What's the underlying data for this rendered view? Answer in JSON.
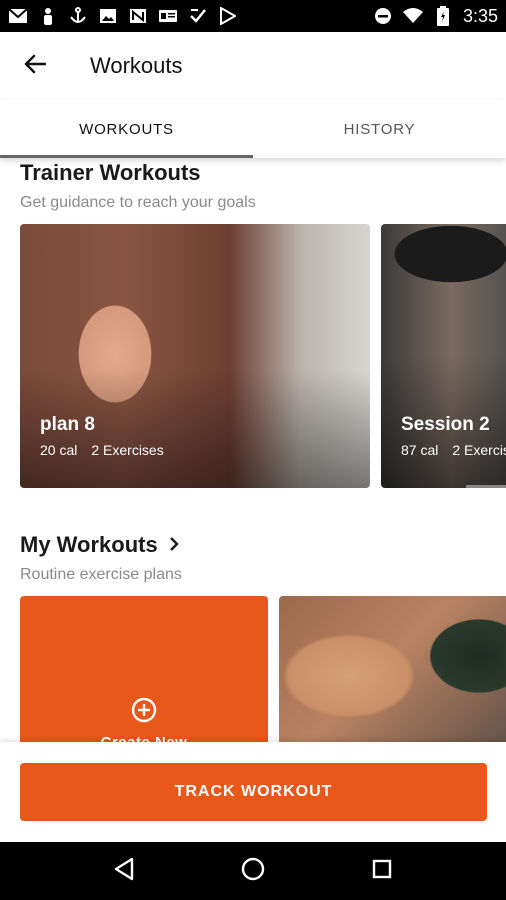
{
  "status_bar": {
    "time": "3:35",
    "left_icons": [
      "gmail-icon",
      "person-icon",
      "anchor-icon",
      "image-icon",
      "news-icon",
      "id-card-icon",
      "checklist-icon",
      "play-store-icon"
    ],
    "right_icons": [
      "do-not-disturb-icon",
      "wifi-icon",
      "battery-icon"
    ]
  },
  "app_bar": {
    "title": "Workouts",
    "back_icon": "arrow-back-icon"
  },
  "tabs": [
    {
      "label": "WORKOUTS",
      "active": true
    },
    {
      "label": "HISTORY",
      "active": false
    }
  ],
  "trainer_section": {
    "title": "Trainer Workouts",
    "subtitle": "Get guidance to reach your goals",
    "cards": [
      {
        "name": "plan 8",
        "calories": "20 cal",
        "exercises": "2 Exercises"
      },
      {
        "name": "Session 2",
        "calories": "87 cal",
        "exercises": "2 Exercis"
      }
    ]
  },
  "my_section": {
    "title": "My Workouts",
    "chevron_icon": "chevron-right-icon",
    "subtitle": "Routine exercise plans",
    "create_label": "Create New"
  },
  "track_button": "TRACK WORKOUT",
  "colors": {
    "accent": "#e8581a",
    "status_bar": "#000000",
    "nav_bar": "#000000"
  },
  "nav_bar": {
    "icons": [
      "back-triangle-icon",
      "home-circle-icon",
      "recents-square-icon"
    ]
  }
}
